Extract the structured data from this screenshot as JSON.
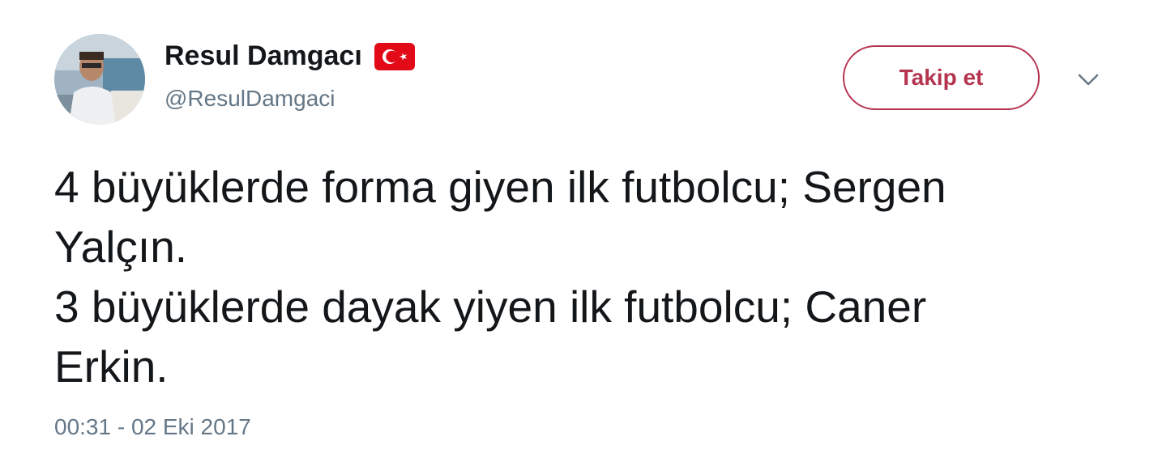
{
  "user": {
    "display_name": "Resul Damgacı",
    "handle": "@ResulDamgaci",
    "flag_icon": "turkey-flag-icon",
    "avatar_icon": "user-photo-avatar"
  },
  "actions": {
    "follow_label": "Takip et",
    "menu_icon": "chevron-down-icon"
  },
  "tweet": {
    "lines": [
      "4 büyüklerde forma giyen ilk futbolcu; Sergen",
      "Yalçın.",
      "3 büyüklerde dayak yiyen ilk futbolcu; Caner",
      "Erkin."
    ],
    "timestamp": "00:31 - 02 Eki 2017"
  },
  "colors": {
    "accent": "#b5344f",
    "text_primary": "#14171a",
    "text_secondary": "#657786",
    "flag_red": "#e30a17"
  }
}
